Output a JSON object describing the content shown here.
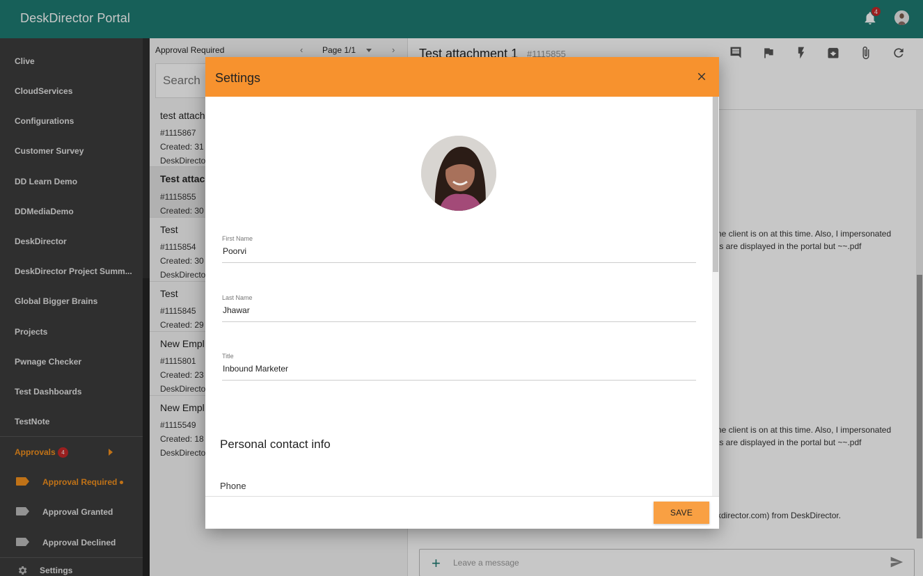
{
  "app": {
    "title": "DeskDirector Portal",
    "notifications_count": "4"
  },
  "sidebar": {
    "items": [
      {
        "label": "Clive"
      },
      {
        "label": "CloudServices"
      },
      {
        "label": "Configurations"
      },
      {
        "label": "Customer Survey"
      },
      {
        "label": "DD Learn Demo"
      },
      {
        "label": "DDMediaDemo"
      },
      {
        "label": "DeskDirector"
      },
      {
        "label": "DeskDirector Project Summ..."
      },
      {
        "label": "Global Bigger Brains"
      },
      {
        "label": "Projects"
      },
      {
        "label": "Pwnage Checker"
      },
      {
        "label": "Test Dashboards"
      },
      {
        "label": "TestNote"
      }
    ],
    "approvals": {
      "label": "Approvals",
      "badge": "4"
    },
    "approval_items": [
      {
        "label": "Approval Required"
      },
      {
        "label": "Approval Granted"
      },
      {
        "label": "Approval Declined"
      }
    ],
    "settings_label": "Settings"
  },
  "list": {
    "heading": "Approval Required",
    "page_label": "Page 1/1",
    "search_placeholder": "Search",
    "tickets": [
      {
        "title": "test attach",
        "id": "#1115867",
        "created": "Created: 31",
        "owner": "DeskDirecto"
      },
      {
        "title": "Test attac",
        "id": "#1115855",
        "created": "Created: 30"
      },
      {
        "title": "Test",
        "id": "#1115854",
        "created": "Created: 30",
        "owner": "DeskDirecto"
      },
      {
        "title": "Test",
        "id": "#1115845",
        "created": "Created: 29"
      },
      {
        "title": "New Empl",
        "id": "#1115801",
        "created": "Created: 23",
        "owner": "DeskDirecto"
      },
      {
        "title": "New Empl",
        "id": "#1115549",
        "created": "Created: 18",
        "owner": "DeskDirecto"
      }
    ]
  },
  "detail": {
    "title": "Test attachment 1",
    "id": "#1115855",
    "body_lines": [
      "ne client is on at this time. Also, I impersonated",
      "ts are displayed in the portal but ~~.pdf",
      "ne client is on at this time. Also, I impersonated",
      "ts are displayed in the portal but ~~.pdf",
      "kdirector.com) from DeskDirector."
    ],
    "composer_placeholder": "Leave a message"
  },
  "modal": {
    "title": "Settings",
    "first_name_label": "First Name",
    "first_name": "Poorvi",
    "last_name_label": "Last Name",
    "last_name": "Jhawar",
    "title_label": "Title",
    "title_value": "Inbound Marketer",
    "section_contact": "Personal contact info",
    "phone_label": "Phone",
    "save_label": "SAVE"
  },
  "colors": {
    "topbar": "#1e7b72",
    "sidebar": "#3d3d3d",
    "accent_orange": "#f7922e",
    "badge_red": "#c62828"
  }
}
